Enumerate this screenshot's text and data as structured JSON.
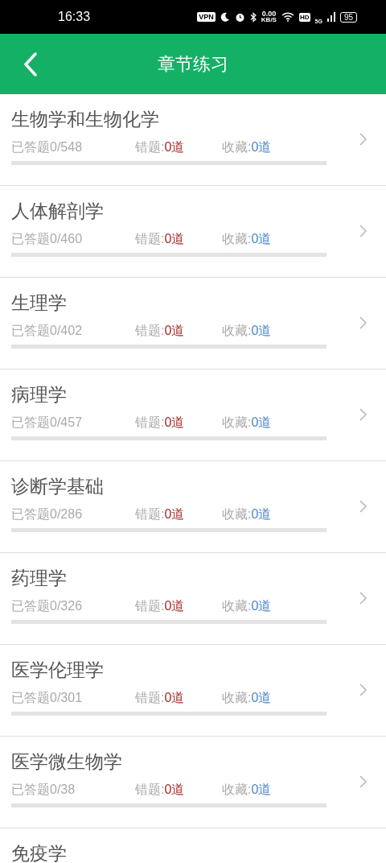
{
  "status_bar": {
    "time": "16:33",
    "vpn": "VPN",
    "speed": "0.00",
    "speed_unit": "KB/S",
    "hd": "HD",
    "network": "5G",
    "battery": "95"
  },
  "header": {
    "title": "章节练习"
  },
  "chapters": [
    {
      "title": "生物学和生物化学",
      "answered": "已答题0/548",
      "wrong_label": "错题:",
      "wrong": "0道",
      "fav_label": "收藏:",
      "fav": "0道",
      "level": 0
    },
    {
      "title": "人体解剖学",
      "answered": "已答题0/460",
      "wrong_label": "错题:",
      "wrong": "0道",
      "fav_label": "收藏:",
      "fav": "0道",
      "level": 0
    },
    {
      "title": "生理学",
      "answered": "已答题0/402",
      "wrong_label": "错题:",
      "wrong": "0道",
      "fav_label": "收藏:",
      "fav": "0道",
      "level": 0
    },
    {
      "title": "病理学",
      "answered": "已答题0/457",
      "wrong_label": "错题:",
      "wrong": "0道",
      "fav_label": "收藏:",
      "fav": "0道",
      "level": 0
    },
    {
      "title": "诊断学基础",
      "answered": "已答题0/286",
      "wrong_label": "错题:",
      "wrong": "0道",
      "fav_label": "收藏:",
      "fav": "0道",
      "level": 0
    },
    {
      "title": "药理学",
      "answered": "已答题0/326",
      "wrong_label": "错题:",
      "wrong": "0道",
      "fav_label": "收藏:",
      "fav": "0道",
      "level": 0
    },
    {
      "title": "医学伦理学",
      "answered": "已答题0/301",
      "wrong_label": "错题:",
      "wrong": "0道",
      "fav_label": "收藏:",
      "fav": "0道",
      "level": 0
    },
    {
      "title": "医学微生物学",
      "answered": "已答题0/38",
      "wrong_label": "错题:",
      "wrong": "0道",
      "fav_label": "收藏:",
      "fav": "0道",
      "level": 0
    },
    {
      "title": "免疫学"
    }
  ]
}
